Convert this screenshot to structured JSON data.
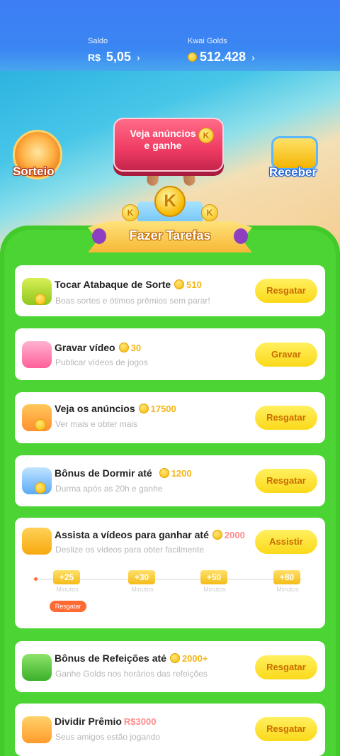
{
  "header": {
    "balance_label": "Saldo",
    "balance_currency": "R$",
    "balance_value": "5,05",
    "golds_label": "Kwai Golds",
    "golds_value": "512.428"
  },
  "promo": {
    "sorteio_label": "Sorteio",
    "receber_label": "Receber",
    "ad_button_label": "Veja anúncios e ganhe",
    "coin_letter": "K"
  },
  "tasks_banner": "Fazer Tarefas",
  "tasks": [
    {
      "title": "Tocar Atabaque de Sorte",
      "reward": "510",
      "subtitle": "Boas sortes e ótimos prêmios sem parar!",
      "button": "Resgatar"
    },
    {
      "title": "Gravar vídeo",
      "reward": "30",
      "subtitle": "Publicar vídeos de jogos",
      "button": "Gravar"
    },
    {
      "title": "Veja os anúncios",
      "reward": "17500",
      "subtitle": "Ver mais e obter mais",
      "button": "Resgatar"
    },
    {
      "title": "Bônus de Dormir até",
      "reward": "1200",
      "subtitle": "Durma após as 20h e ganhe",
      "button": "Resgatar"
    },
    {
      "title": "Assista a vídeos para ganhar até",
      "reward": "2000",
      "subtitle": "Deslize os vídeos para obter facilmente",
      "button": "Assistir",
      "milestones": [
        {
          "value": "+25",
          "label": "Minutos"
        },
        {
          "value": "+30",
          "label": "Minutos"
        },
        {
          "value": "+50",
          "label": "Minutos"
        },
        {
          "value": "+80",
          "label": "Minutos"
        }
      ],
      "claim_label": "Resgatar"
    },
    {
      "title": "Bônus de Refeições até",
      "reward": "2000+",
      "subtitle": "Ganhe Golds nos horários das refeições",
      "button": "Resgatar"
    },
    {
      "title": "Dividir Prêmio",
      "reward": "R$3000",
      "subtitle": "Seus amigos estão jogando",
      "button": "Resgatar"
    }
  ],
  "colors": {
    "header_blue": "#3a86f2",
    "board_green": "#42c92a",
    "button_yellow": "#fbd91a",
    "button_text": "#c96c00",
    "reward_gold": "#f5b515"
  }
}
